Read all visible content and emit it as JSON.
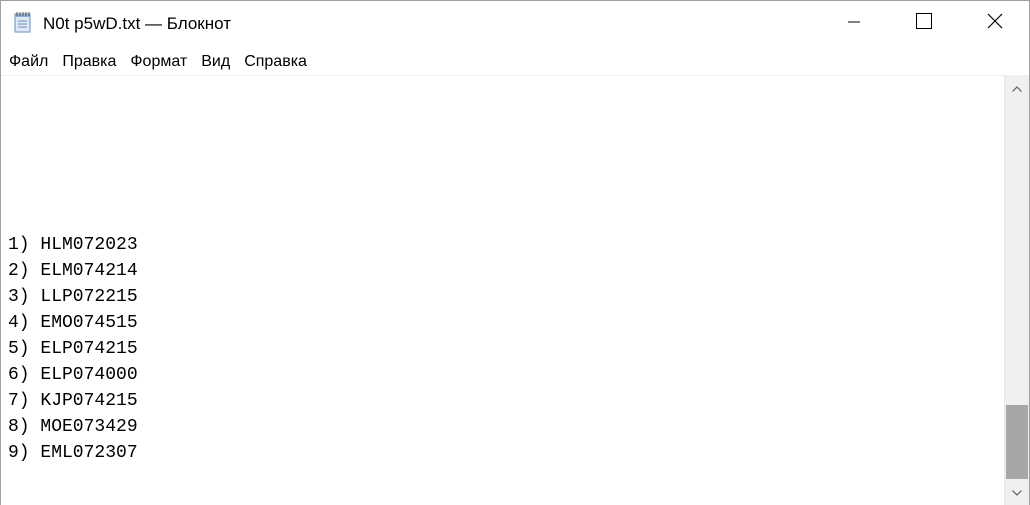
{
  "window": {
    "title": "N0t p5wD.txt — Блокнот",
    "app_icon": "notepad-icon",
    "controls": {
      "minimize_icon": "minimize-icon",
      "maximize_icon": "maximize-icon",
      "close_icon": "close-icon"
    }
  },
  "menu": {
    "items": [
      {
        "label": "Файл"
      },
      {
        "label": "Правка"
      },
      {
        "label": "Формат"
      },
      {
        "label": "Вид"
      },
      {
        "label": "Справка"
      }
    ]
  },
  "document": {
    "lines": [
      "1) HLM072023",
      "2) ELM074214",
      "3) LLP072215",
      "4) EMO074515",
      "5) ELP074215",
      "6) ELP074000",
      "7) KJP074215",
      "8) MOE073429",
      "9) EML072307"
    ]
  },
  "scrollbar": {
    "up_icon": "scroll-up-arrow-icon",
    "down_icon": "scroll-down-arrow-icon",
    "thumb_color": "#a6a6a6",
    "track_color": "#f0f0f0"
  }
}
